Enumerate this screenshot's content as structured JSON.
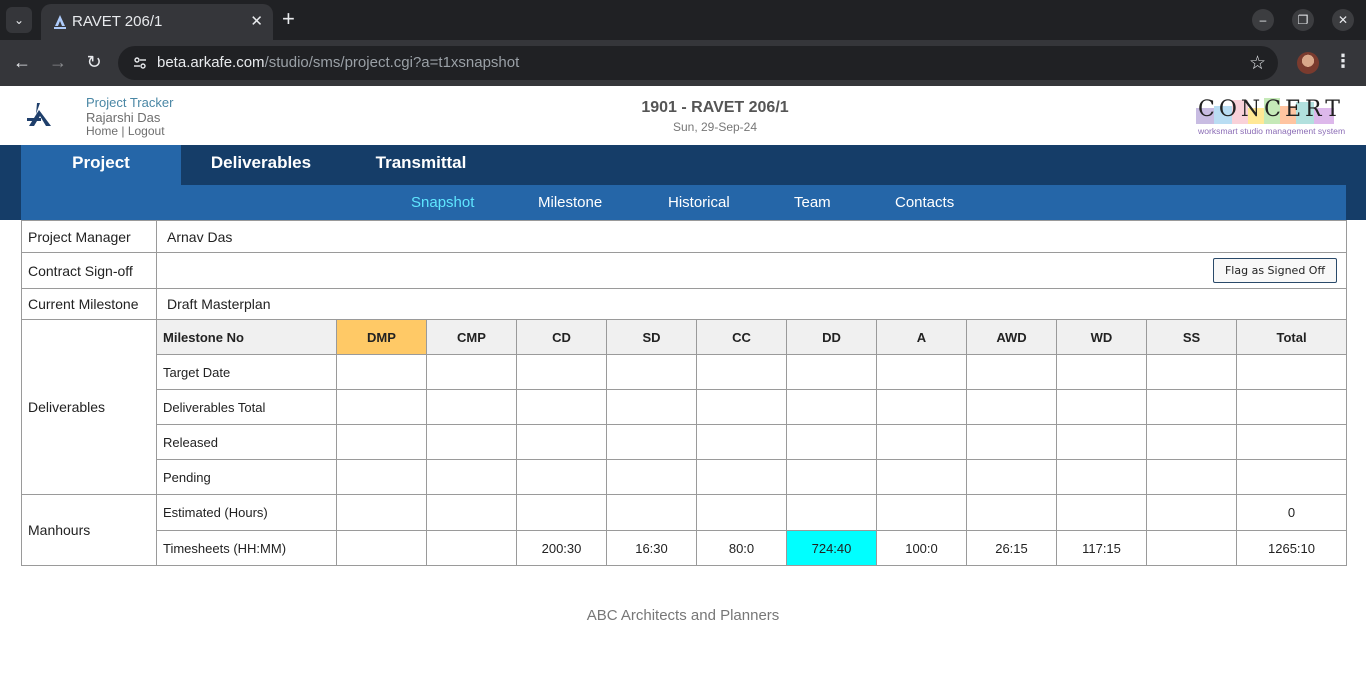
{
  "browser": {
    "tab_title": "RAVET 206/1",
    "url_domain": "beta.arkafe.com",
    "url_path": "/studio/sms/project.cgi?a=t1xsnapshot"
  },
  "header": {
    "app_name": "Project Tracker",
    "user": "Rajarshi Das",
    "home_link": "Home",
    "separator": "|",
    "logout_link": "Logout",
    "project_title": "1901 - RAVET 206/1",
    "date": "Sun, 29-Sep-24",
    "brand_logo_text": "CONCERT",
    "brand_tagline": "worksmart studio management system"
  },
  "nav": {
    "primary": [
      "Project",
      "Deliverables",
      "Transmittal"
    ],
    "secondary": [
      "Snapshot",
      "Milestone",
      "Historical",
      "Team",
      "Contacts"
    ]
  },
  "project": {
    "manager_label": "Project Manager",
    "manager_value": "Arnav Das",
    "contract_label": "Contract Sign-off",
    "flag_button": "Flag as Signed Off",
    "milestone_label": "Current Milestone",
    "milestone_value": "Draft Masterplan"
  },
  "grid": {
    "deliverables_label": "Deliverables",
    "manhours_label": "Manhours",
    "header_label": "Milestone No",
    "columns": [
      "DMP",
      "CMP",
      "CD",
      "SD",
      "CC",
      "DD",
      "A",
      "AWD",
      "WD",
      "SS",
      "Total"
    ],
    "rows": {
      "target_date": {
        "label": "Target Date",
        "values": [
          "",
          "",
          "",
          "",
          "",
          "",
          "",
          "",
          "",
          "",
          ""
        ]
      },
      "deliverables_total": {
        "label": "Deliverables Total",
        "values": [
          "",
          "",
          "",
          "",
          "",
          "",
          "",
          "",
          "",
          "",
          ""
        ]
      },
      "released": {
        "label": "Released",
        "values": [
          "",
          "",
          "",
          "",
          "",
          "",
          "",
          "",
          "",
          "",
          ""
        ]
      },
      "pending": {
        "label": "Pending",
        "values": [
          "",
          "",
          "",
          "",
          "",
          "",
          "",
          "",
          "",
          "",
          ""
        ]
      },
      "estimated": {
        "label": "Estimated (Hours)",
        "values": [
          "",
          "",
          "",
          "",
          "",
          "",
          "",
          "",
          "",
          "",
          "0"
        ]
      },
      "timesheets": {
        "label": "Timesheets (HH:MM)",
        "values": [
          "",
          "",
          "200:30",
          "16:30",
          "80:0",
          "724:40",
          "100:0",
          "26:15",
          "117:15",
          "",
          "1265:10"
        ]
      }
    },
    "highlight_colors": {
      "current_milestone": "#ffc966",
      "max_hours": "#00ffff"
    }
  },
  "footer": "ABC Architects and Planners"
}
